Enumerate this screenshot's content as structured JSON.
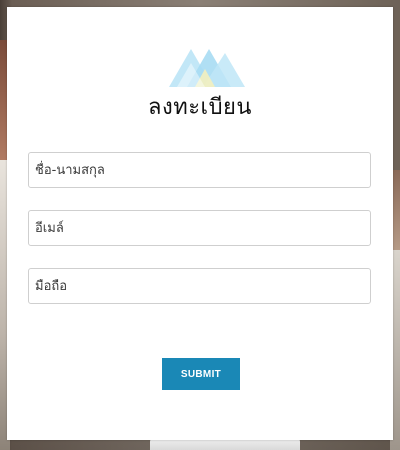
{
  "form": {
    "title": "ลงทะเบียน",
    "fields": [
      {
        "placeholder": "ชื่อ-นามสกุล",
        "value": ""
      },
      {
        "placeholder": "อีเมล์",
        "value": ""
      },
      {
        "placeholder": "มือถือ",
        "value": ""
      }
    ],
    "submit_label": "SUBMIT"
  },
  "logo": {
    "icon": "mountain-peaks-logo",
    "colors": [
      "#bfe6f7",
      "#a7dcf3",
      "#f3efbf"
    ]
  },
  "theme": {
    "accent": "#1a88b6"
  }
}
